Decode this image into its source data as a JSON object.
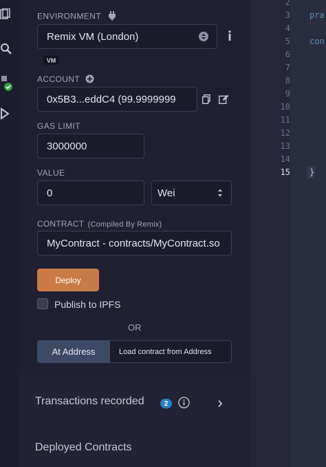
{
  "environment": {
    "label": "ENVIRONMENT",
    "value": "Remix VM (London)",
    "badge": "VM"
  },
  "account": {
    "label": "ACCOUNT",
    "value": "0x5B3...eddC4 (99.9999999"
  },
  "gas_limit": {
    "label": "GAS LIMIT",
    "value": "3000000"
  },
  "value_field": {
    "label": "VALUE",
    "amount": "0",
    "unit": "Wei"
  },
  "contract": {
    "label": "CONTRACT",
    "label_note": "(Compiled By Remix)",
    "value": "MyContract - contracts/MyContract.sol"
  },
  "actions": {
    "deploy": "Deploy",
    "publish_ipfs": "Publish to IPFS",
    "or": "OR",
    "at_address": "At Address",
    "load_placeholder": "Load contract from Address"
  },
  "transactions": {
    "title": "Transactions recorded",
    "count": "2"
  },
  "deployed": {
    "title": "Deployed Contracts"
  },
  "editor": {
    "line_numbers": [
      "2",
      "3",
      "4",
      "5",
      "6",
      "7",
      "8",
      "9",
      "10",
      "11",
      "12",
      "13",
      "14",
      "15"
    ],
    "active_line": "15",
    "code_lines": [
      {
        "line": "3",
        "text": "pra"
      },
      {
        "line": "5",
        "text": "con"
      },
      {
        "line": "15",
        "text": "}"
      }
    ]
  },
  "colors": {
    "accent": "#c97a45",
    "badge": "#2b7fc0",
    "success": "#2ea043"
  }
}
